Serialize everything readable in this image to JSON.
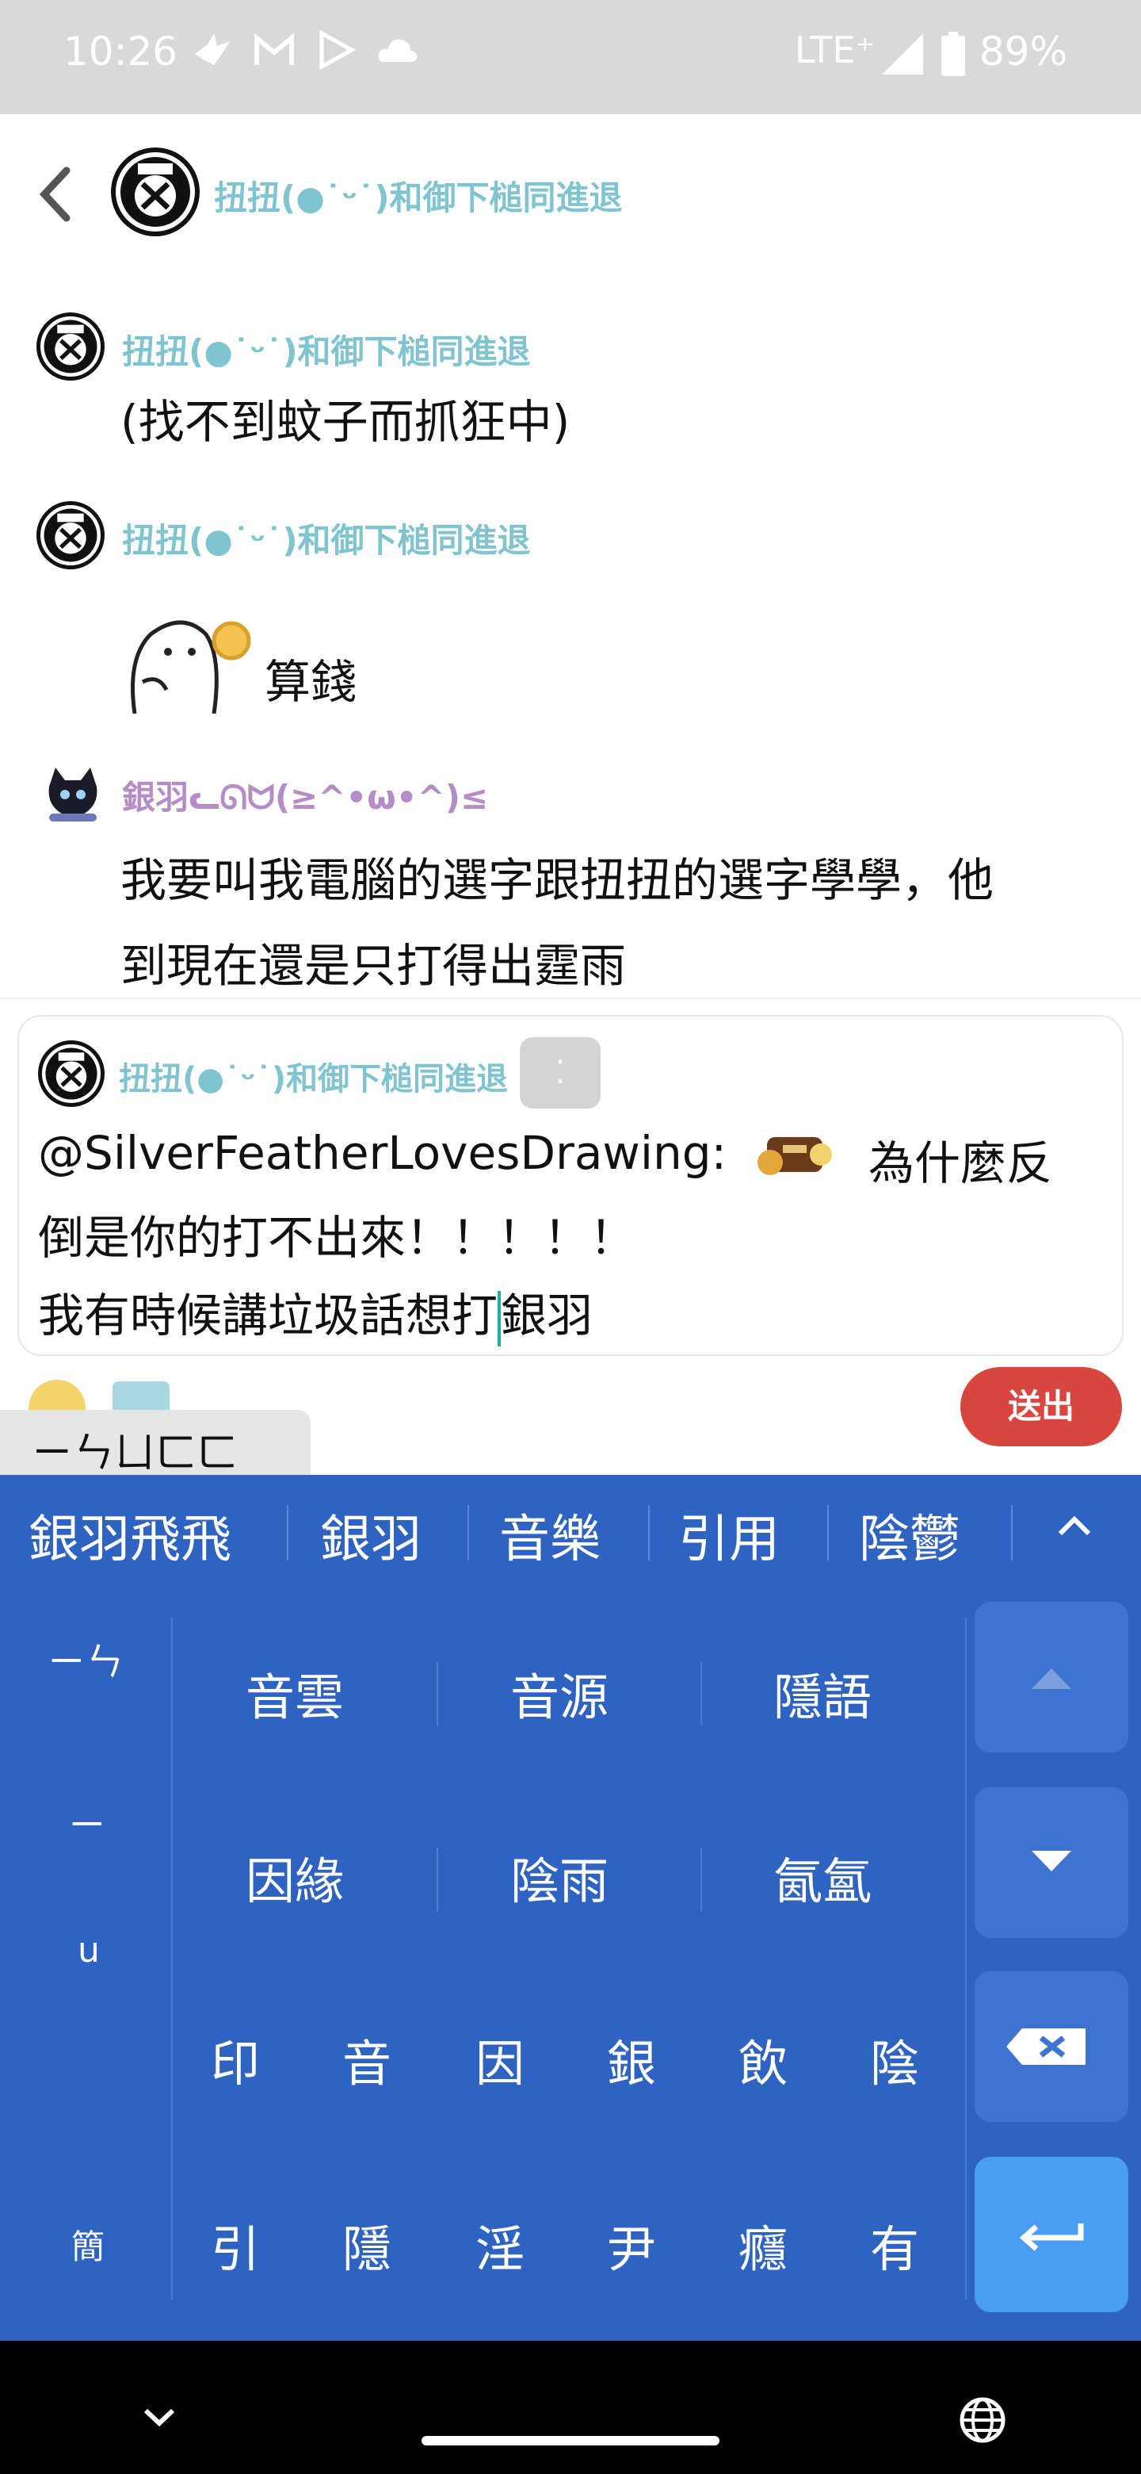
{
  "status_bar": {
    "time": "10:26",
    "network": "LTE⁺",
    "battery": "89%"
  },
  "header": {
    "title": "扭扭(●˙ᵕ˙)和御下槌同進退"
  },
  "messages": [
    {
      "user": "扭扭(●˙ᵕ˙)和御下槌同進退",
      "text": "(找不到蚊子而抓狂中)"
    },
    {
      "user": "扭扭(●˙ᵕ˙)和御下槌同進退",
      "text": "算錢"
    },
    {
      "user": "銀羽ᓚᘏᗢ(≥^•ω•^)≤",
      "line1": "我要叫我電腦的選字跟扭扭的選字學學，他",
      "line2": "到現在還是只打得出霆雨"
    }
  ],
  "compose": {
    "user": "扭扭(●˙ᵕ˙)和御下槌同進退",
    "menu": "⁚",
    "line1_prefix": "@SilverFeatherLovesDrawing:",
    "line1_suffix": "為什麼反",
    "line2": "倒是你的打不出來！！！！！",
    "line3_a": "我有時候講垃圾話想打",
    "line3_b": "銀羽",
    "send_label": "送出"
  },
  "ime": {
    "composing": "ㄧㄣㄩㄈㄈ",
    "candidates_top": [
      "銀羽飛飛",
      "銀羽",
      "音樂",
      "引用",
      "陰鬱"
    ],
    "left_column": [
      "ㄧㄣ",
      "ㄧ",
      "u",
      "簡"
    ],
    "row1": [
      "音雲",
      "音源",
      "隱語"
    ],
    "row2": [
      "因緣",
      "陰雨",
      "氤氳"
    ],
    "row3": [
      "印",
      "音",
      "因",
      "銀",
      "飲",
      "陰"
    ],
    "row4": [
      "引",
      "隱",
      "淫",
      "尹",
      "癮",
      "有"
    ]
  },
  "colors": {
    "keyboard_bg": "#2f63c2",
    "send_button": "#d9453f",
    "username": "#7fc4cf",
    "username_alt": "#b48dc6"
  }
}
